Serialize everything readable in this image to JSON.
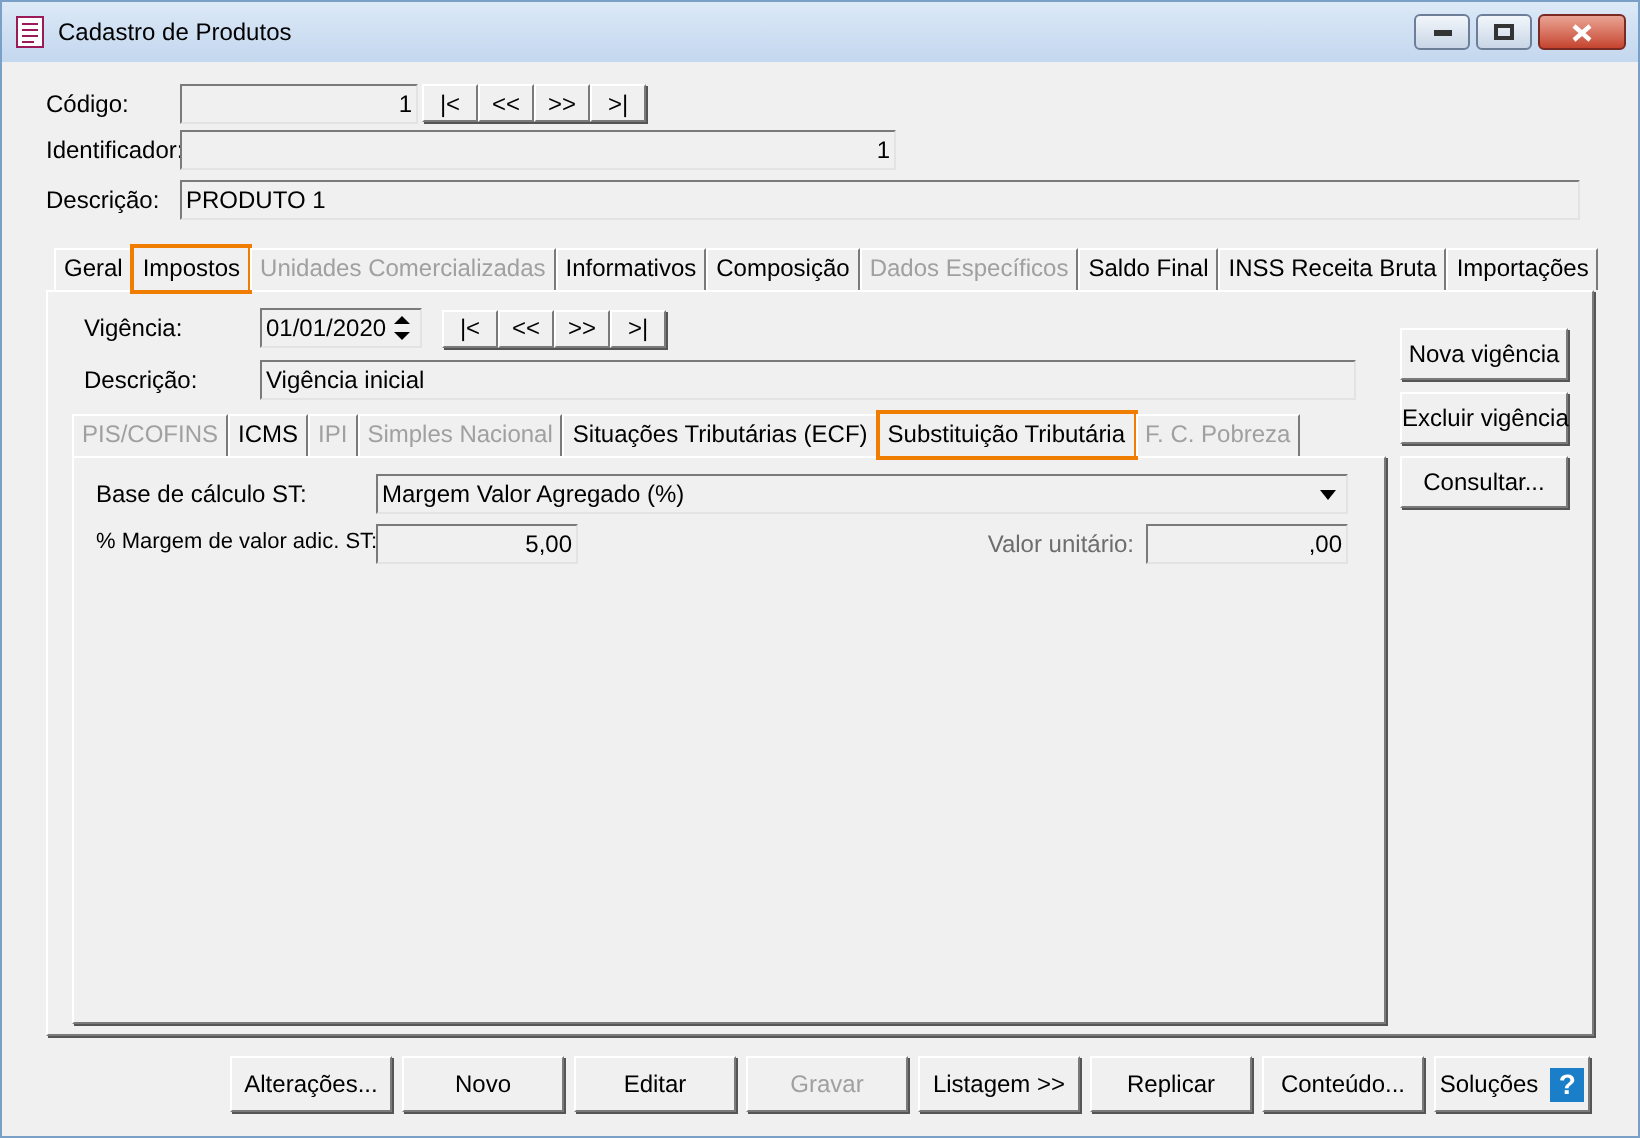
{
  "window": {
    "title": "Cadastro de Produtos"
  },
  "header": {
    "codigo_label": "Código:",
    "codigo": "1",
    "identificador_label": "Identificador:",
    "identificador": "1",
    "descricao_label": "Descrição:",
    "descricao": "PRODUTO 1"
  },
  "nav_buttons": [
    "|<",
    "<<",
    ">>",
    ">|"
  ],
  "tabs": [
    {
      "label": "Geral",
      "selected": false,
      "disabled": false,
      "highlighted": false
    },
    {
      "label": "Impostos",
      "selected": true,
      "disabled": false,
      "highlighted": true
    },
    {
      "label": "Unidades Comercializadas",
      "selected": false,
      "disabled": true,
      "highlighted": false
    },
    {
      "label": "Informativos",
      "selected": false,
      "disabled": false,
      "highlighted": false
    },
    {
      "label": "Composição",
      "selected": false,
      "disabled": false,
      "highlighted": false
    },
    {
      "label": "Dados Específicos",
      "selected": false,
      "disabled": true,
      "highlighted": false
    },
    {
      "label": "Saldo Final",
      "selected": false,
      "disabled": false,
      "highlighted": false
    },
    {
      "label": "INSS Receita Bruta",
      "selected": false,
      "disabled": false,
      "highlighted": false
    },
    {
      "label": "Importações",
      "selected": false,
      "disabled": false,
      "highlighted": false
    }
  ],
  "vigencia": {
    "label": "Vigência:",
    "value": "01/01/2020",
    "nav_buttons": [
      "|<",
      "<<",
      ">>",
      ">|"
    ],
    "descricao_label": "Descrição:",
    "descricao": "Vigência inicial"
  },
  "inner_tabs": [
    {
      "label": "PIS/COFINS",
      "selected": false,
      "disabled": true,
      "highlighted": false
    },
    {
      "label": "ICMS",
      "selected": false,
      "disabled": false,
      "highlighted": false
    },
    {
      "label": "IPI",
      "selected": false,
      "disabled": true,
      "highlighted": false
    },
    {
      "label": "Simples Nacional",
      "selected": false,
      "disabled": true,
      "highlighted": false
    },
    {
      "label": "Situações Tributárias (ECF)",
      "selected": false,
      "disabled": false,
      "highlighted": false
    },
    {
      "label": "Substituição Tributária",
      "selected": true,
      "disabled": false,
      "highlighted": true
    },
    {
      "label": "F. C. Pobreza",
      "selected": false,
      "disabled": true,
      "highlighted": false
    }
  ],
  "st_form": {
    "base_label": "Base de cálculo ST:",
    "base_value": "Margem Valor Agregado (%)",
    "margem_label": "% Margem de valor adic. ST:",
    "margem_value": "5,00",
    "valor_label": "Valor unitário:",
    "valor_value": ",00"
  },
  "side_buttons": [
    "Nova vigência",
    "Excluir vigência",
    "Consultar..."
  ],
  "bottom_buttons": [
    {
      "label": "Alterações...",
      "disabled": false
    },
    {
      "label": "Novo",
      "disabled": false
    },
    {
      "label": "Editar",
      "disabled": false
    },
    {
      "label": "Gravar",
      "disabled": true
    },
    {
      "label": "Listagem >>",
      "disabled": false
    },
    {
      "label": "Replicar",
      "disabled": false
    },
    {
      "label": "Conteúdo...",
      "disabled": false
    }
  ],
  "help_button": {
    "label": "Soluções",
    "icon_text": "?"
  }
}
